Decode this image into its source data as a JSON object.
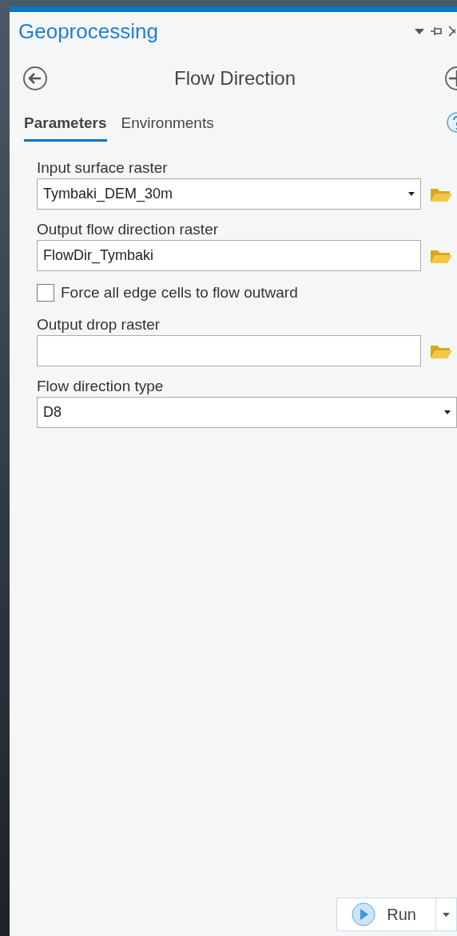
{
  "pane": {
    "title": "Geoprocessing"
  },
  "tool": {
    "title": "Flow Direction"
  },
  "tabs": [
    {
      "label": "Parameters",
      "selected": true
    },
    {
      "label": "Environments",
      "selected": false
    }
  ],
  "parameters": [
    {
      "kind": "dropdown",
      "label": "Input surface raster",
      "value": "Tymbaki_DEM_30m",
      "browse": true
    },
    {
      "kind": "text",
      "label": "Output flow direction raster",
      "value": "FlowDir_Tymbaki",
      "browse": true
    },
    {
      "kind": "checkbox",
      "label": "Force all edge cells to flow outward",
      "checked": false
    },
    {
      "kind": "text",
      "label": "Output drop raster",
      "browse": true
    },
    {
      "kind": "dropdown",
      "label": "Flow direction type",
      "value": "D8",
      "browse": false
    }
  ],
  "run_button": {
    "label": "Run"
  }
}
